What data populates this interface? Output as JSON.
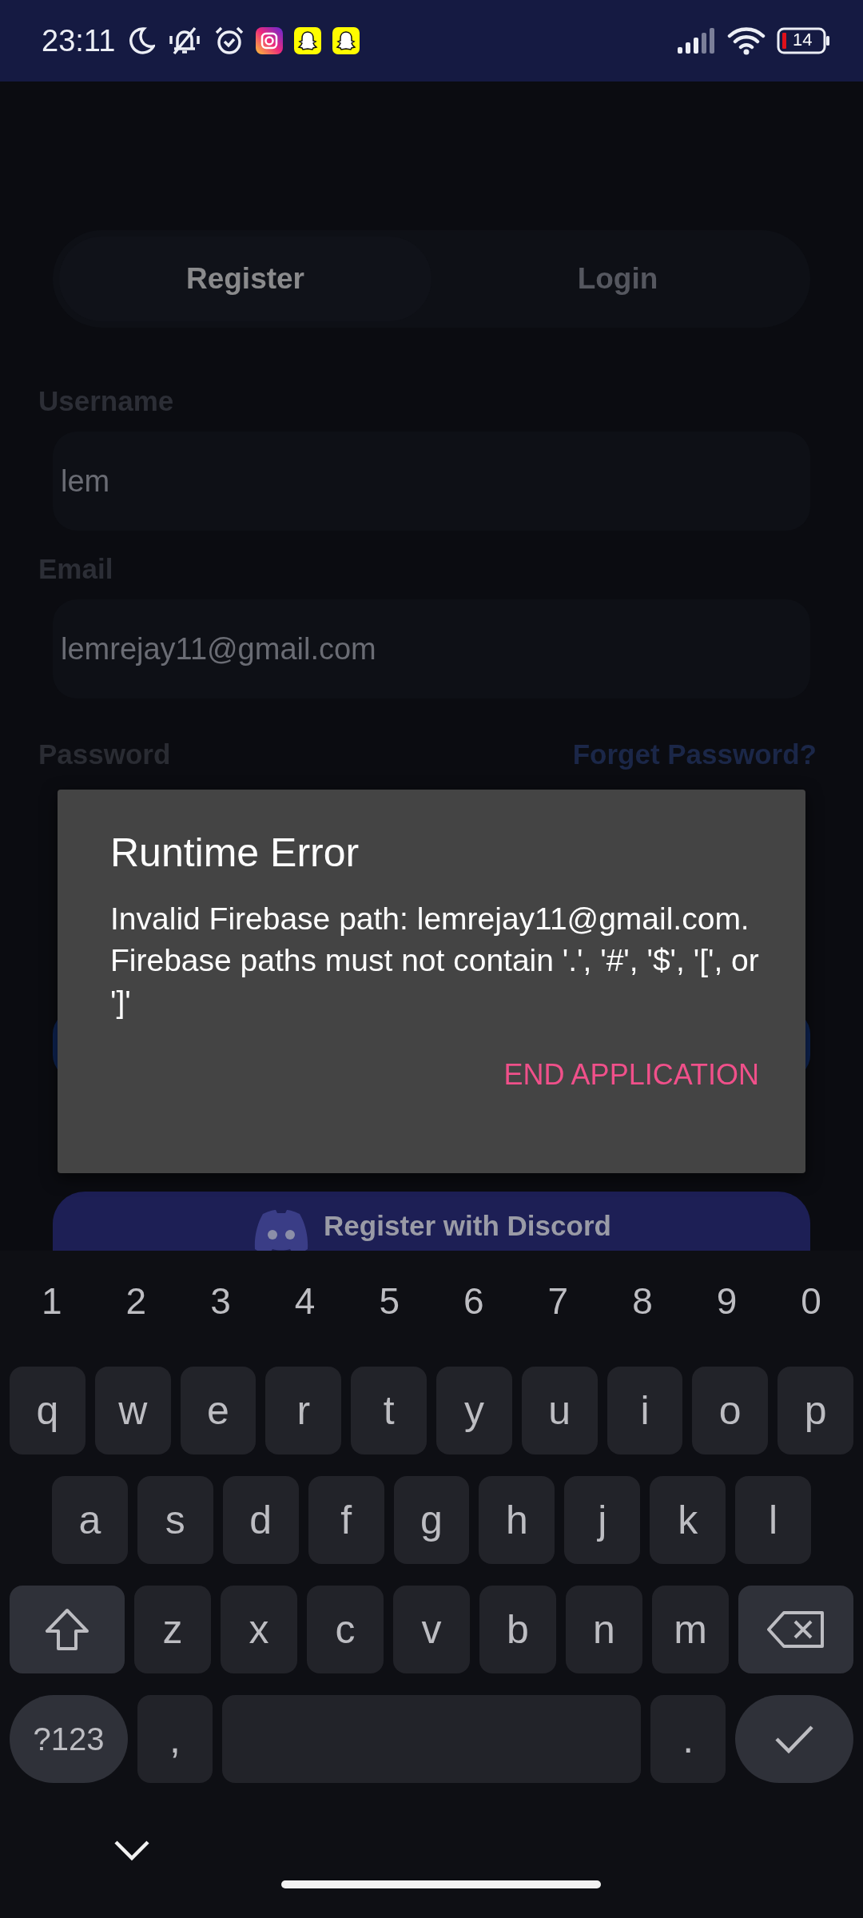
{
  "status_bar": {
    "time": "23:11",
    "battery": "14"
  },
  "tabs": [
    {
      "label": "Register",
      "selected": true
    },
    {
      "label": "Login",
      "selected": false
    }
  ],
  "fields": [
    {
      "label": "Username",
      "value": "lem"
    },
    {
      "label": "Email",
      "value": "lemrejay11@gmail.com"
    }
  ],
  "password": {
    "label": "Password",
    "link": "Forget Password?"
  },
  "discord_button": {
    "label": "Register with Discord"
  },
  "dialog": {
    "title": "Runtime Error",
    "message": "Invalid Firebase path: lemrejay11@gmail.com. Firebase paths must not contain '.', '#', '$', '[', or ']'",
    "action": "END APPLICATION"
  },
  "keyboard": {
    "number_row": [
      "1",
      "2",
      "3",
      "4",
      "5",
      "6",
      "7",
      "8",
      "9",
      "0"
    ],
    "rows": [
      {
        "keys": [
          {
            "kind": "char",
            "label": "q"
          },
          {
            "kind": "char",
            "label": "w"
          },
          {
            "kind": "char",
            "label": "e"
          },
          {
            "kind": "char",
            "label": "r"
          },
          {
            "kind": "char",
            "label": "t"
          },
          {
            "kind": "char",
            "label": "y"
          },
          {
            "kind": "char",
            "label": "u"
          },
          {
            "kind": "char",
            "label": "i"
          },
          {
            "kind": "char",
            "label": "o"
          },
          {
            "kind": "char",
            "label": "p"
          }
        ]
      },
      {
        "keys": [
          {
            "kind": "char",
            "label": "a"
          },
          {
            "kind": "char",
            "label": "s"
          },
          {
            "kind": "char",
            "label": "d"
          },
          {
            "kind": "char",
            "label": "f"
          },
          {
            "kind": "char",
            "label": "g"
          },
          {
            "kind": "char",
            "label": "h"
          },
          {
            "kind": "char",
            "label": "j"
          },
          {
            "kind": "char",
            "label": "k"
          },
          {
            "kind": "char",
            "label": "l"
          }
        ]
      },
      {
        "keys": [
          {
            "kind": "shift"
          },
          {
            "kind": "char",
            "label": "z"
          },
          {
            "kind": "char",
            "label": "x"
          },
          {
            "kind": "char",
            "label": "c"
          },
          {
            "kind": "char",
            "label": "v"
          },
          {
            "kind": "char",
            "label": "b"
          },
          {
            "kind": "char",
            "label": "n"
          },
          {
            "kind": "char",
            "label": "m"
          },
          {
            "kind": "backspace"
          }
        ]
      },
      {
        "keys": [
          {
            "kind": "symbols",
            "label": "?123"
          },
          {
            "kind": "char",
            "label": ","
          },
          {
            "kind": "space"
          },
          {
            "kind": "char",
            "label": "."
          },
          {
            "kind": "enter"
          }
        ]
      }
    ]
  }
}
